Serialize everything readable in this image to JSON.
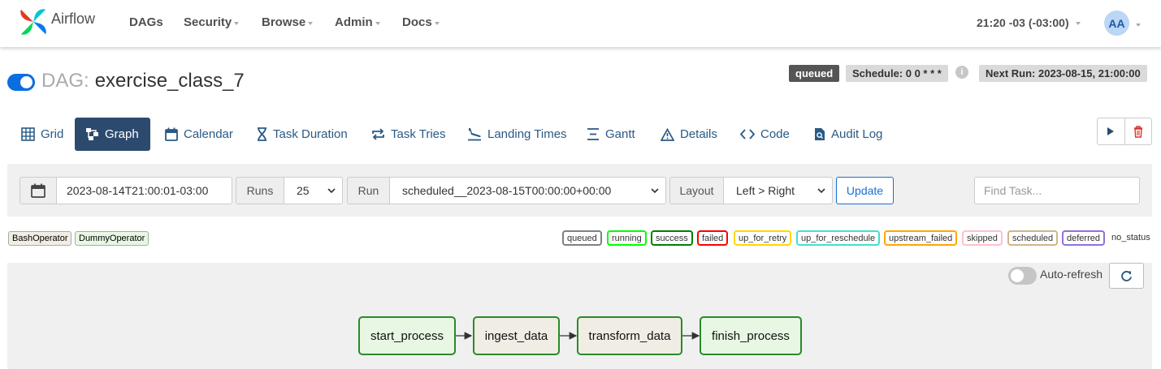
{
  "navbar": {
    "brand": "Airflow",
    "items": [
      {
        "label": "DAGs",
        "dropdown": false
      },
      {
        "label": "Security",
        "dropdown": true
      },
      {
        "label": "Browse",
        "dropdown": true
      },
      {
        "label": "Admin",
        "dropdown": true
      },
      {
        "label": "Docs",
        "dropdown": true
      }
    ],
    "clock": "21:20 -03 (-03:00)",
    "user_initials": "AA"
  },
  "dag": {
    "prefix": "DAG:",
    "id": "exercise_class_7",
    "paused": false,
    "state_badge": "queued",
    "schedule": "Schedule: 0 0 * * *",
    "info_icon": "i",
    "next_run": "Next Run: 2023-08-15, 21:00:00"
  },
  "tabs": [
    {
      "label": "Grid",
      "icon": "grid-icon",
      "active": false
    },
    {
      "label": "Graph",
      "icon": "graph-icon",
      "active": true
    },
    {
      "label": "Calendar",
      "icon": "calendar-icon",
      "active": false
    },
    {
      "label": "Task Duration",
      "icon": "hourglass-icon",
      "active": false
    },
    {
      "label": "Task Tries",
      "icon": "repeat-icon",
      "active": false
    },
    {
      "label": "Landing Times",
      "icon": "plane-landing-icon",
      "active": false
    },
    {
      "label": "Gantt",
      "icon": "gantt-icon",
      "active": false
    },
    {
      "label": "Details",
      "icon": "warning-triangle-icon",
      "active": false
    },
    {
      "label": "Code",
      "icon": "code-icon",
      "active": false
    },
    {
      "label": "Audit Log",
      "icon": "file-search-icon",
      "active": false
    }
  ],
  "actions": {
    "trigger": "play-icon",
    "delete": "trash-icon"
  },
  "filters": {
    "base_date": "2023-08-14T21:00:01-03:00",
    "runs_label": "Runs",
    "runs_value": "25",
    "run_label": "Run",
    "run_value": "scheduled__2023-08-15T00:00:00+00:00",
    "layout_label": "Layout",
    "layout_value": "Left > Right",
    "update_label": "Update",
    "find_placeholder": "Find Task..."
  },
  "operators": [
    {
      "label": "BashOperator",
      "color": "#f0ede4"
    },
    {
      "label": "DummyOperator",
      "color": "#e8f7e4"
    }
  ],
  "states": [
    {
      "label": "queued",
      "color": "#808080"
    },
    {
      "label": "running",
      "color": "#00ff00"
    },
    {
      "label": "success",
      "color": "#008000"
    },
    {
      "label": "failed",
      "color": "#ff0000"
    },
    {
      "label": "up_for_retry",
      "color": "#ffd700"
    },
    {
      "label": "up_for_reschedule",
      "color": "#40e0d0"
    },
    {
      "label": "upstream_failed",
      "color": "#ffa500"
    },
    {
      "label": "skipped",
      "color": "#ffc0cb"
    },
    {
      "label": "scheduled",
      "color": "#d2b48c"
    },
    {
      "label": "deferred",
      "color": "#9370db"
    }
  ],
  "no_status_label": "no_status",
  "graph": {
    "auto_refresh_label": "Auto-refresh",
    "auto_refresh_on": false,
    "tasks": [
      {
        "label": "start_process",
        "operator": "DummyOperator",
        "color": "#e8f7e4",
        "state": "success"
      },
      {
        "label": "ingest_data",
        "operator": "BashOperator",
        "color": "#f0ede4",
        "state": "success"
      },
      {
        "label": "transform_data",
        "operator": "BashOperator",
        "color": "#f0ede4",
        "state": "success"
      },
      {
        "label": "finish_process",
        "operator": "DummyOperator",
        "color": "#e8f7e4",
        "state": "success"
      }
    ]
  }
}
